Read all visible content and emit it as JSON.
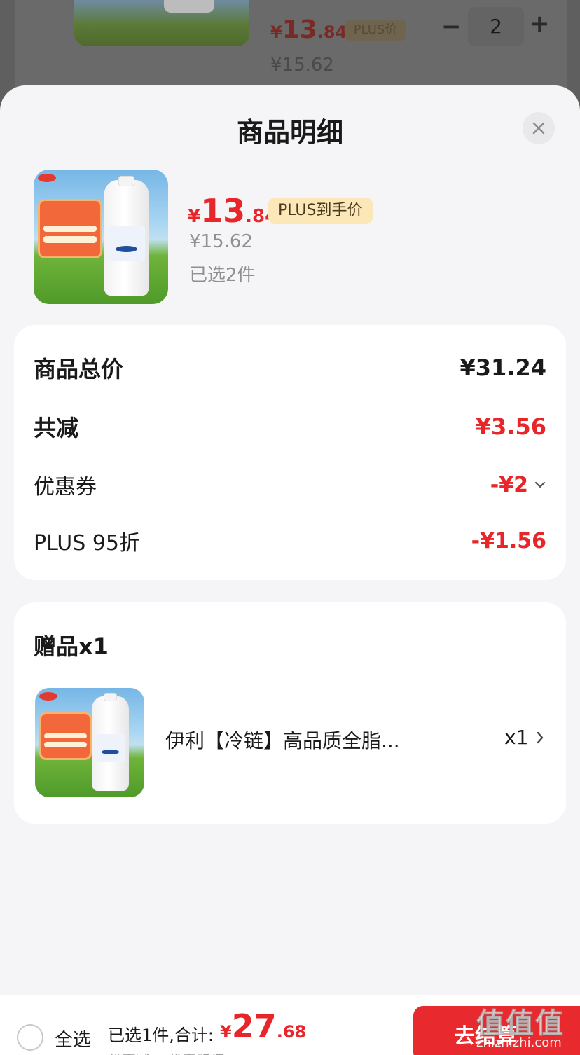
{
  "background_cart": {
    "price_symbol": "¥",
    "price_integer": "13",
    "price_decimal": ".84",
    "plus_tag": "PLUS价",
    "original_price": "¥15.62",
    "minus_label": "−",
    "quantity": "2",
    "plus_label": "+"
  },
  "sheet": {
    "title": "商品明细",
    "close_icon": "close-icon"
  },
  "product": {
    "price_symbol": "¥",
    "price_integer": "13",
    "price_decimal": ".84",
    "plus_badge": "PLUS到手价",
    "original_price": "¥15.62",
    "selected_count": "已选2件"
  },
  "summary": {
    "total_label": "商品总价",
    "total_value": "¥31.24",
    "reduce_label": "共减",
    "reduce_value": "¥3.56",
    "coupon_label": "优惠券",
    "coupon_value": "-¥2",
    "plus_discount_label": "PLUS 95折",
    "plus_discount_value": "-¥1.56"
  },
  "gift": {
    "title": "赠品x1",
    "name": "伊利【冷链】高品质全脂...",
    "qty": "x1"
  },
  "bottom_bar": {
    "select_all": "全选",
    "total_text": "已选1件,合计:",
    "total_symbol": "¥",
    "total_integer": "27",
    "total_decimal": ".68",
    "sub_text": "优惠减…  优惠明细",
    "checkout": "去结算"
  },
  "watermark": {
    "logo": "值值值",
    "site": "zhizhizhi.com"
  },
  "colors": {
    "accent_red": "#e8262a",
    "plus_badge_bg": "#fbe7b7",
    "sheet_bg": "#f5f5f7"
  }
}
